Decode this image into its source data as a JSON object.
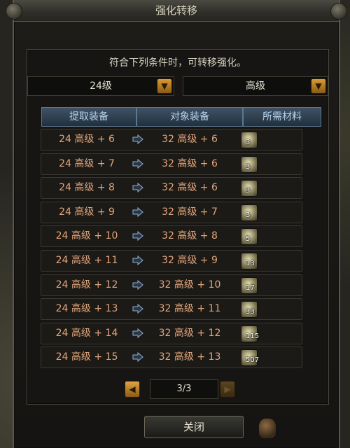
{
  "window": {
    "title": "强化转移"
  },
  "notice": "符合下列条件时，可转移强化。",
  "dropdowns": {
    "level": "24级",
    "grade": "高级"
  },
  "columns": [
    "提取装备",
    "对象装备",
    "所需材料"
  ],
  "rows": [
    {
      "source": "24 高级 + 6",
      "target": "32 高级 + 6",
      "count": "3"
    },
    {
      "source": "24 高级 + 7",
      "target": "32 高级 + 6",
      "count": "3"
    },
    {
      "source": "24 高级 + 8",
      "target": "32 高级 + 6",
      "count": "3"
    },
    {
      "source": "24 高级 + 9",
      "target": "32 高级 + 7",
      "count": "3"
    },
    {
      "source": "24 高级 + 10",
      "target": "32 高级 + 8",
      "count": "5"
    },
    {
      "source": "24 高级 + 11",
      "target": "32 高级 + 9",
      "count": "13"
    },
    {
      "source": "24 高级 + 12",
      "target": "32 高级 + 10",
      "count": "17"
    },
    {
      "source": "24 高级 + 13",
      "target": "32 高级 + 11",
      "count": "33"
    },
    {
      "source": "24 高级 + 14",
      "target": "32 高级 + 12",
      "count": "115"
    },
    {
      "source": "24 高级 + 15",
      "target": "32 高级 + 13",
      "count": "507"
    }
  ],
  "pager": {
    "label": "3/3"
  },
  "footer": {
    "close_label": "关闭"
  },
  "colors": {
    "accent": "#d79b36",
    "row_text": "#e3a57a",
    "header_text": "#b8d4ec"
  },
  "icons": {
    "row_arrow": "arrow-right-icon",
    "material": "material-gem-icon",
    "prev": "chevron-left-icon",
    "next": "chevron-right-icon"
  }
}
